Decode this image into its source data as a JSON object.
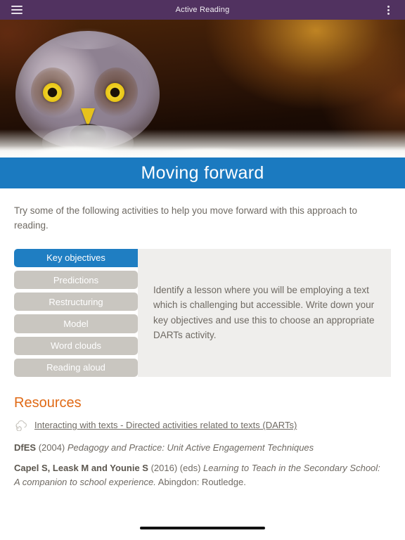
{
  "appbar": {
    "title": "Active Reading",
    "menu_icon": "hamburger-icon",
    "overflow_icon": "kebab-icon"
  },
  "hero": {
    "alt": "Great grey owl close-up in snow"
  },
  "page": {
    "title": "Moving forward",
    "intro": "Try some of the following activities to help you move forward with this approach to reading."
  },
  "activity": {
    "tabs": [
      {
        "label": "Key objectives",
        "active": true
      },
      {
        "label": "Predictions",
        "active": false
      },
      {
        "label": "Restructuring",
        "active": false
      },
      {
        "label": "Model",
        "active": false
      },
      {
        "label": "Word clouds",
        "active": false
      },
      {
        "label": "Reading aloud",
        "active": false
      }
    ],
    "panel_text": "Identify a lesson where you will be employing a text which is challenging but accessible. Write down your key objectives and use this to choose an appropriate DARTs activity."
  },
  "resources": {
    "heading": "Resources",
    "link_icon": "cloud-download-icon",
    "link_label": "Interacting with texts - Directed activities related to texts (DARTs)",
    "references": [
      {
        "authors": "DfES",
        "year": "(2004)",
        "title": "Pedagogy and Practice: Unit Active Engagement Techniques",
        "tail": ""
      },
      {
        "authors": "Capel S, Leask M and Younie S",
        "year": "(2016) (eds)",
        "title": "Learning to Teach in the Secondary School: A companion to school experience.",
        "tail": " Abingdon: Routledge."
      }
    ]
  },
  "colors": {
    "appbar": "#513260",
    "title_band": "#1b7ac0",
    "tab_active": "#1f7ec2",
    "tab_inactive": "#c9c6c0",
    "panel_bg": "#efeeec",
    "accent_orange": "#e06a16",
    "body_text": "#6f6a63"
  },
  "navbar": {
    "home_indicator": "home-pill"
  }
}
